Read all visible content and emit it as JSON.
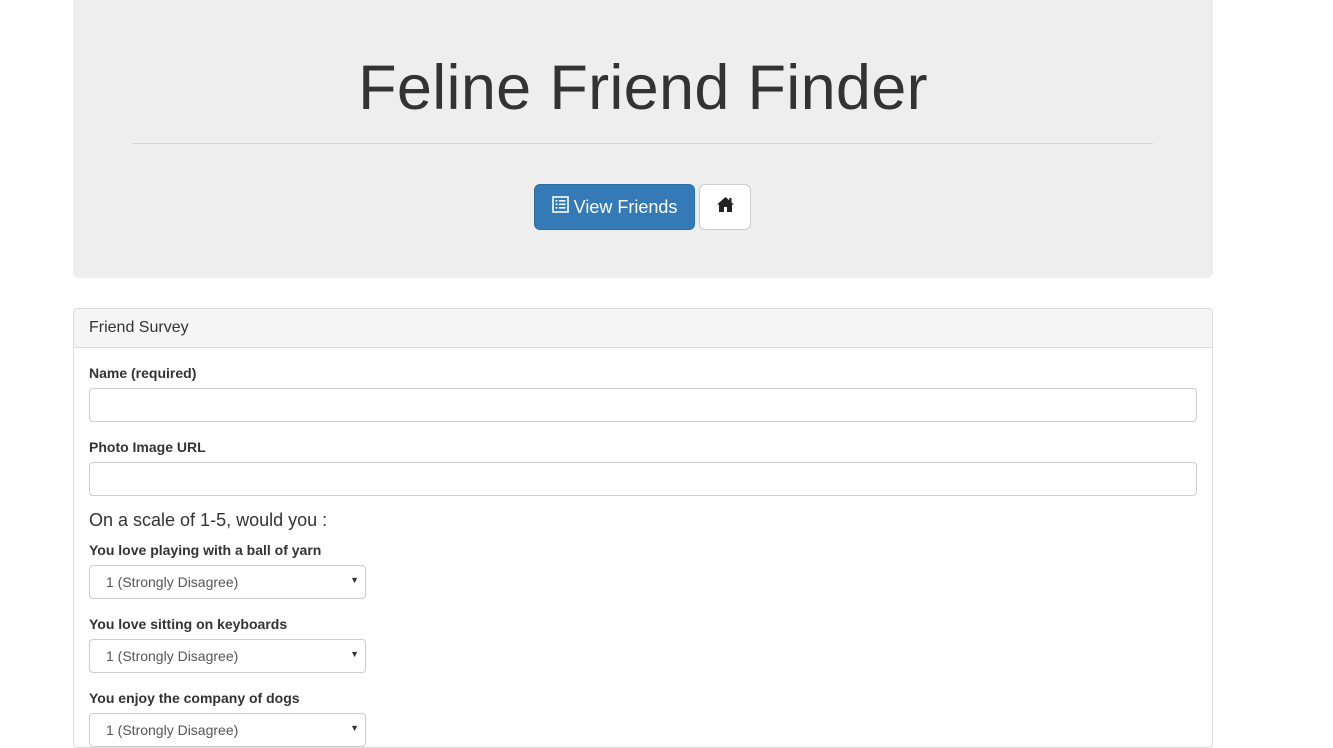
{
  "header": {
    "title": "Feline Friend Finder",
    "view_friends_label": "View Friends",
    "list_icon": "list-alt-icon",
    "home_icon": "home-icon"
  },
  "survey": {
    "panel_title": "Friend Survey",
    "name_label": "Name (required)",
    "name_value": "",
    "photo_label": "Photo Image URL",
    "photo_value": "",
    "scale_heading": "On a scale of 1-5, would you :",
    "questions": [
      {
        "label": "You love playing with a ball of yarn",
        "selected": "1 (Strongly Disagree)"
      },
      {
        "label": "You love sitting on keyboards",
        "selected": "1 (Strongly Disagree)"
      },
      {
        "label": "You enjoy the company of dogs",
        "selected": "1 (Strongly Disagree)"
      }
    ]
  },
  "colors": {
    "primary": "#337ab7",
    "jumbotron_bg": "#eeeeee",
    "panel_heading_bg": "#f5f5f5"
  }
}
